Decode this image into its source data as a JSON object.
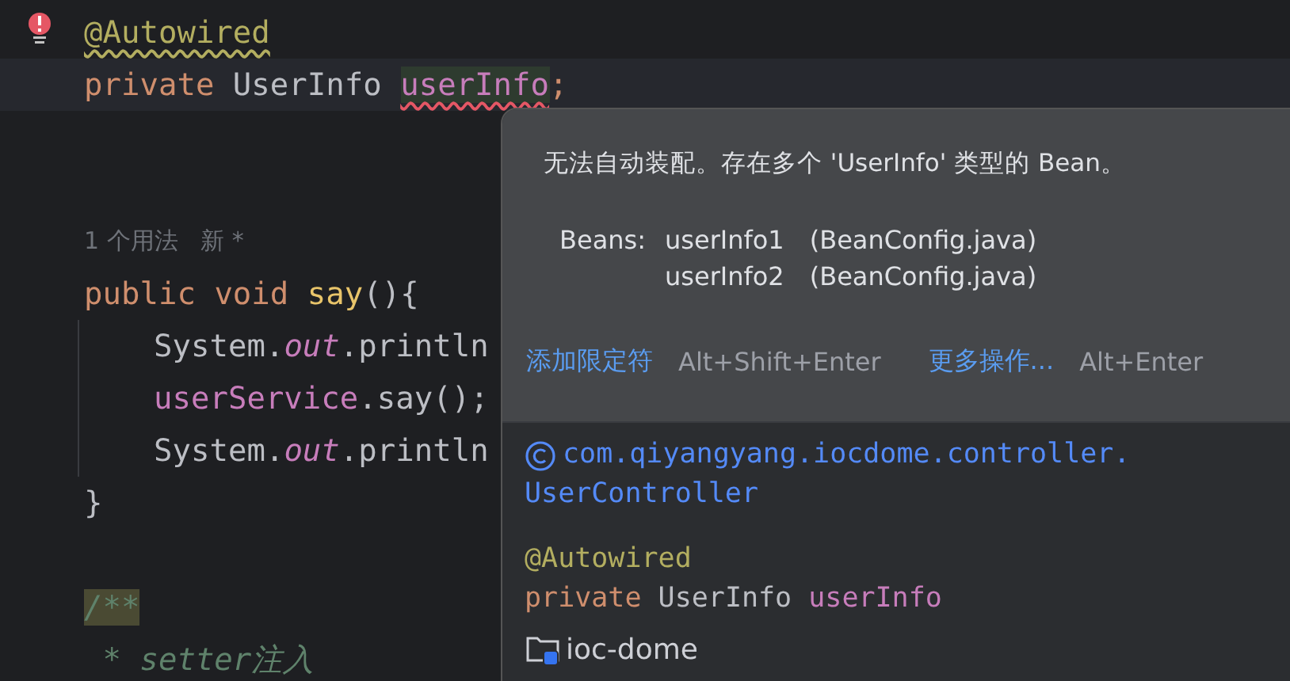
{
  "editor": {
    "lines": [
      {
        "kind": "code",
        "current": false,
        "gutter_error": true,
        "tokens": [
          {
            "text": "@Autowired",
            "kind": "annotation",
            "warning": true
          }
        ]
      },
      {
        "kind": "code",
        "current": true,
        "gutter_error": false,
        "tokens": [
          {
            "text": "private ",
            "kind": "keyword"
          },
          {
            "text": "UserInfo ",
            "kind": "plain"
          },
          {
            "text": "userInfo",
            "kind": "field",
            "error": true
          },
          {
            "text": ";",
            "kind": "keyword"
          }
        ]
      },
      {
        "kind": "blank"
      },
      {
        "kind": "blank"
      },
      {
        "kind": "hint",
        "text": "1 个用法   新 *"
      },
      {
        "kind": "code",
        "current": false,
        "gutter_error": false,
        "tokens": [
          {
            "text": "public ",
            "kind": "keyword"
          },
          {
            "text": "void ",
            "kind": "keyword"
          },
          {
            "text": "say",
            "kind": "method"
          },
          {
            "text": "(){",
            "kind": "plain"
          }
        ],
        "children": [
          {
            "kind": "code",
            "current": false,
            "gutter_error": false,
            "tokens": [
              {
                "text": "System.",
                "kind": "plain"
              },
              {
                "text": "out",
                "kind": "static"
              },
              {
                "text": ".println",
                "kind": "plain"
              }
            ]
          },
          {
            "kind": "code",
            "current": false,
            "gutter_error": false,
            "tokens": [
              {
                "text": "userService",
                "kind": "field"
              },
              {
                "text": ".say();",
                "kind": "plain"
              }
            ]
          },
          {
            "kind": "code",
            "current": false,
            "gutter_error": false,
            "tokens": [
              {
                "text": "System.",
                "kind": "plain"
              },
              {
                "text": "out",
                "kind": "static"
              },
              {
                "text": ".println",
                "kind": "plain"
              }
            ]
          }
        ]
      },
      {
        "kind": "code",
        "current": false,
        "gutter_error": false,
        "tokens": [
          {
            "text": "}",
            "kind": "plain"
          }
        ]
      },
      {
        "kind": "blank"
      },
      {
        "kind": "code",
        "current": false,
        "gutter_error": false,
        "tokens": [
          {
            "text": "/**",
            "kind": "comment",
            "highlighted": true
          }
        ]
      },
      {
        "kind": "code",
        "current": false,
        "gutter_error": false,
        "tokens": [
          {
            "text": " * setter注入",
            "kind": "comment"
          }
        ]
      }
    ]
  },
  "popup": {
    "message": "无法自动装配。存在多个 'UserInfo' 类型的 Bean。",
    "beans_label": "Beans:",
    "beans": [
      {
        "name": "userInfo1",
        "source": "(BeanConfig.java)"
      },
      {
        "name": "userInfo2",
        "source": "(BeanConfig.java)"
      }
    ],
    "actions": [
      {
        "label": "添加限定符",
        "shortcut": "Alt+Shift+Enter"
      },
      {
        "label": "更多操作...",
        "shortcut": "Alt+Enter"
      }
    ],
    "declaration": {
      "class_path": "com.qiyangyang.iocdome.controller.",
      "class_name": "UserController",
      "code": [
        [
          {
            "text": "@Autowired",
            "kind": "annotation"
          }
        ],
        [
          {
            "text": "private ",
            "kind": "keyword"
          },
          {
            "text": "UserInfo ",
            "kind": "plain"
          },
          {
            "text": "userInfo",
            "kind": "field"
          }
        ]
      ],
      "module": "ioc-dome"
    }
  }
}
